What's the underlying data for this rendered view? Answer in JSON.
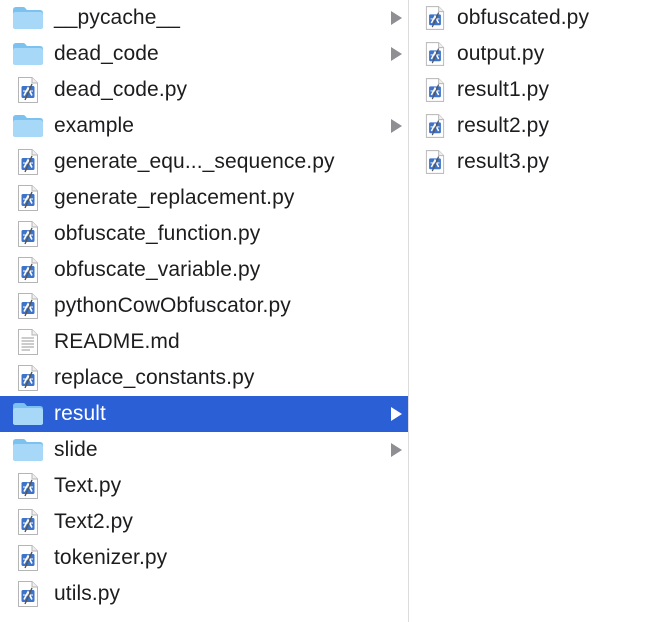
{
  "left_column": {
    "items": [
      {
        "label": "__pycache__",
        "kind": "folder",
        "has_children": true,
        "selected": false,
        "icon": "folder-icon",
        "name": "item-pycache"
      },
      {
        "label": "dead_code",
        "kind": "folder",
        "has_children": true,
        "selected": false,
        "icon": "folder-icon",
        "name": "item-dead-code-folder"
      },
      {
        "label": "dead_code.py",
        "kind": "python",
        "has_children": false,
        "selected": false,
        "icon": "python-file-icon",
        "name": "item-dead-code-py"
      },
      {
        "label": "example",
        "kind": "folder",
        "has_children": true,
        "selected": false,
        "icon": "folder-icon",
        "name": "item-example"
      },
      {
        "label": "generate_equ..._sequence.py",
        "kind": "python",
        "has_children": false,
        "selected": false,
        "icon": "python-file-icon",
        "name": "item-generate-equ-sequence"
      },
      {
        "label": "generate_replacement.py",
        "kind": "python",
        "has_children": false,
        "selected": false,
        "icon": "python-file-icon",
        "name": "item-generate-replacement"
      },
      {
        "label": "obfuscate_function.py",
        "kind": "python",
        "has_children": false,
        "selected": false,
        "icon": "python-file-icon",
        "name": "item-obfuscate-function"
      },
      {
        "label": "obfuscate_variable.py",
        "kind": "python",
        "has_children": false,
        "selected": false,
        "icon": "python-file-icon",
        "name": "item-obfuscate-variable"
      },
      {
        "label": "pythonCowObfuscator.py",
        "kind": "python",
        "has_children": false,
        "selected": false,
        "icon": "python-file-icon",
        "name": "item-python-cow-obfuscator"
      },
      {
        "label": "README.md",
        "kind": "markdown",
        "has_children": false,
        "selected": false,
        "icon": "text-file-icon",
        "name": "item-readme"
      },
      {
        "label": "replace_constants.py",
        "kind": "python",
        "has_children": false,
        "selected": false,
        "icon": "python-file-icon",
        "name": "item-replace-constants"
      },
      {
        "label": "result",
        "kind": "folder",
        "has_children": true,
        "selected": true,
        "icon": "folder-icon",
        "name": "item-result"
      },
      {
        "label": "slide",
        "kind": "folder",
        "has_children": true,
        "selected": false,
        "icon": "folder-icon",
        "name": "item-slide"
      },
      {
        "label": "Text.py",
        "kind": "python",
        "has_children": false,
        "selected": false,
        "icon": "python-file-icon",
        "name": "item-text-py"
      },
      {
        "label": "Text2.py",
        "kind": "python",
        "has_children": false,
        "selected": false,
        "icon": "python-file-icon",
        "name": "item-text2-py"
      },
      {
        "label": "tokenizer.py",
        "kind": "python",
        "has_children": false,
        "selected": false,
        "icon": "python-file-icon",
        "name": "item-tokenizer"
      },
      {
        "label": "utils.py",
        "kind": "python",
        "has_children": false,
        "selected": false,
        "icon": "python-file-icon",
        "name": "item-utils"
      }
    ]
  },
  "right_column": {
    "items": [
      {
        "label": "obfuscated.py",
        "kind": "python",
        "icon": "python-file-icon",
        "name": "item-obfuscated"
      },
      {
        "label": "output.py",
        "kind": "python",
        "icon": "python-file-icon",
        "name": "item-output"
      },
      {
        "label": "result1.py",
        "kind": "python",
        "icon": "python-file-icon",
        "name": "item-result1"
      },
      {
        "label": "result2.py",
        "kind": "python",
        "icon": "python-file-icon",
        "name": "item-result2"
      },
      {
        "label": "result3.py",
        "kind": "python",
        "icon": "python-file-icon",
        "name": "item-result3"
      }
    ]
  },
  "colors": {
    "selection": "#2a5fd6",
    "folder_light": "#a8d8f7",
    "folder_dark": "#7cc2f0",
    "arrow": "#8e8e93"
  }
}
